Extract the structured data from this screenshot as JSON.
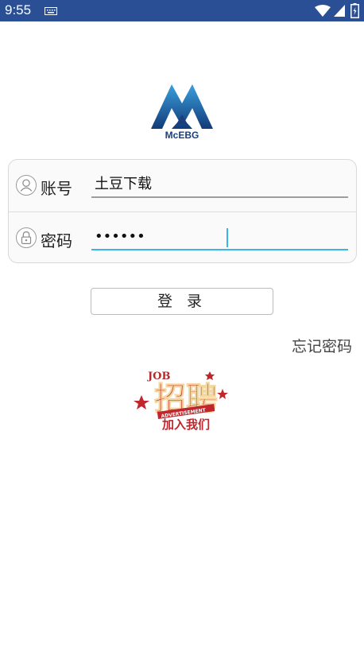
{
  "status_bar": {
    "time": "9:55",
    "icons": [
      "keyboard-icon",
      "wifi-icon",
      "cell-signal-icon",
      "battery-icon"
    ]
  },
  "logo": {
    "text": "McEBG"
  },
  "form": {
    "username_label": "账号",
    "username_value": "土豆下载",
    "password_label": "密码",
    "password_value": "••••••"
  },
  "login_button": {
    "label": "登 录"
  },
  "forgot_link": {
    "label": "忘记密码"
  },
  "recruit_banner": {
    "main_text": "招聘",
    "top_text": "JOB",
    "sub_text": "ADVERTISEMENT",
    "bottom_text": "加入我们"
  },
  "colors": {
    "status_bar": "#2a4f94",
    "accent": "#38b6e8",
    "logo_blue": "#1b3f7c",
    "recruit_red": "#c0262b"
  }
}
